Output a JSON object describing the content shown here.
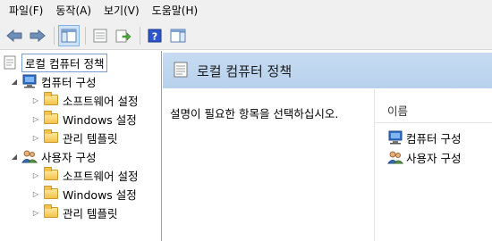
{
  "menu": {
    "items": [
      "파일(F)",
      "동작(A)",
      "보기(V)",
      "도움말(H)"
    ]
  },
  "toolbar": {
    "buttons": [
      "back-icon",
      "forward-icon",
      "show-tree-icon",
      "properties-icon",
      "export-icon",
      "help-icon",
      "show-action-pane-icon"
    ]
  },
  "tree": {
    "root": "로컬 컴퓨터 정책",
    "computer_config": "컴퓨터 구성",
    "computer_children": [
      "소프트웨어 설정",
      "Windows 설정",
      "관리 템플릿"
    ],
    "user_config": "사용자 구성",
    "user_children": [
      "소프트웨어 설정",
      "Windows 설정",
      "관리 템플릿"
    ]
  },
  "detail": {
    "title": "로컬 컴퓨터 정책",
    "description": "설명이 필요한 항목을 선택하십시오.",
    "column_header": "이름",
    "items": [
      "컴퓨터 구성",
      "사용자 구성"
    ]
  },
  "colors": {
    "header_gradient": "#c7dcf2",
    "selection_border": "#7a9cd3",
    "help_icon": "#2c55c8"
  }
}
